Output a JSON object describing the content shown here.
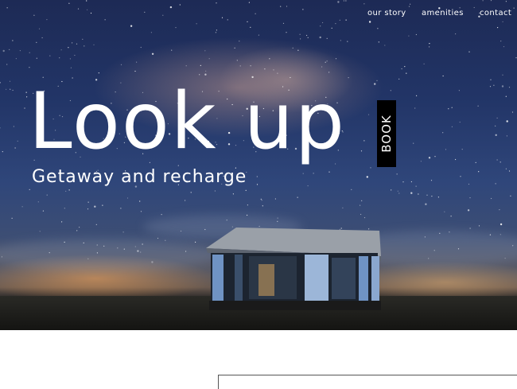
{
  "nav": {
    "items": [
      {
        "label": "our story"
      },
      {
        "label": "amenities"
      },
      {
        "label": "contact"
      }
    ]
  },
  "hero": {
    "headline": "Look up",
    "subheadline": "Getaway and recharge",
    "book_label": "BOOK"
  },
  "colors": {
    "text": "#ffffff",
    "book_bg": "#000000",
    "sky": "#223567",
    "page_bg": "#ffffff"
  }
}
